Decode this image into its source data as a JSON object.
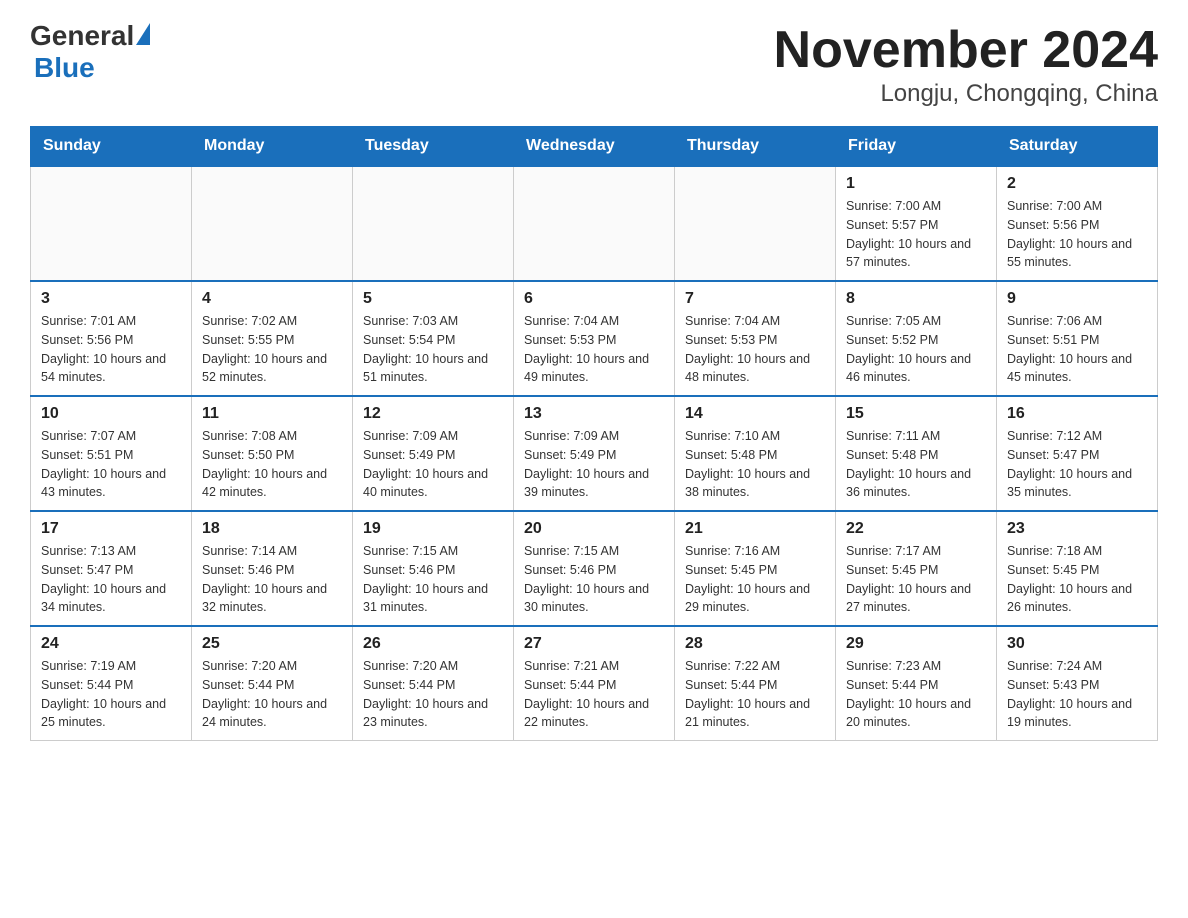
{
  "header": {
    "logo_general": "General",
    "logo_blue": "Blue",
    "title": "November 2024",
    "subtitle": "Longju, Chongqing, China"
  },
  "calendar": {
    "days_of_week": [
      "Sunday",
      "Monday",
      "Tuesday",
      "Wednesday",
      "Thursday",
      "Friday",
      "Saturday"
    ],
    "weeks": [
      [
        {
          "day": "",
          "sunrise": "",
          "sunset": "",
          "daylight": ""
        },
        {
          "day": "",
          "sunrise": "",
          "sunset": "",
          "daylight": ""
        },
        {
          "day": "",
          "sunrise": "",
          "sunset": "",
          "daylight": ""
        },
        {
          "day": "",
          "sunrise": "",
          "sunset": "",
          "daylight": ""
        },
        {
          "day": "",
          "sunrise": "",
          "sunset": "",
          "daylight": ""
        },
        {
          "day": "1",
          "sunrise": "Sunrise: 7:00 AM",
          "sunset": "Sunset: 5:57 PM",
          "daylight": "Daylight: 10 hours and 57 minutes."
        },
        {
          "day": "2",
          "sunrise": "Sunrise: 7:00 AM",
          "sunset": "Sunset: 5:56 PM",
          "daylight": "Daylight: 10 hours and 55 minutes."
        }
      ],
      [
        {
          "day": "3",
          "sunrise": "Sunrise: 7:01 AM",
          "sunset": "Sunset: 5:56 PM",
          "daylight": "Daylight: 10 hours and 54 minutes."
        },
        {
          "day": "4",
          "sunrise": "Sunrise: 7:02 AM",
          "sunset": "Sunset: 5:55 PM",
          "daylight": "Daylight: 10 hours and 52 minutes."
        },
        {
          "day": "5",
          "sunrise": "Sunrise: 7:03 AM",
          "sunset": "Sunset: 5:54 PM",
          "daylight": "Daylight: 10 hours and 51 minutes."
        },
        {
          "day": "6",
          "sunrise": "Sunrise: 7:04 AM",
          "sunset": "Sunset: 5:53 PM",
          "daylight": "Daylight: 10 hours and 49 minutes."
        },
        {
          "day": "7",
          "sunrise": "Sunrise: 7:04 AM",
          "sunset": "Sunset: 5:53 PM",
          "daylight": "Daylight: 10 hours and 48 minutes."
        },
        {
          "day": "8",
          "sunrise": "Sunrise: 7:05 AM",
          "sunset": "Sunset: 5:52 PM",
          "daylight": "Daylight: 10 hours and 46 minutes."
        },
        {
          "day": "9",
          "sunrise": "Sunrise: 7:06 AM",
          "sunset": "Sunset: 5:51 PM",
          "daylight": "Daylight: 10 hours and 45 minutes."
        }
      ],
      [
        {
          "day": "10",
          "sunrise": "Sunrise: 7:07 AM",
          "sunset": "Sunset: 5:51 PM",
          "daylight": "Daylight: 10 hours and 43 minutes."
        },
        {
          "day": "11",
          "sunrise": "Sunrise: 7:08 AM",
          "sunset": "Sunset: 5:50 PM",
          "daylight": "Daylight: 10 hours and 42 minutes."
        },
        {
          "day": "12",
          "sunrise": "Sunrise: 7:09 AM",
          "sunset": "Sunset: 5:49 PM",
          "daylight": "Daylight: 10 hours and 40 minutes."
        },
        {
          "day": "13",
          "sunrise": "Sunrise: 7:09 AM",
          "sunset": "Sunset: 5:49 PM",
          "daylight": "Daylight: 10 hours and 39 minutes."
        },
        {
          "day": "14",
          "sunrise": "Sunrise: 7:10 AM",
          "sunset": "Sunset: 5:48 PM",
          "daylight": "Daylight: 10 hours and 38 minutes."
        },
        {
          "day": "15",
          "sunrise": "Sunrise: 7:11 AM",
          "sunset": "Sunset: 5:48 PM",
          "daylight": "Daylight: 10 hours and 36 minutes."
        },
        {
          "day": "16",
          "sunrise": "Sunrise: 7:12 AM",
          "sunset": "Sunset: 5:47 PM",
          "daylight": "Daylight: 10 hours and 35 minutes."
        }
      ],
      [
        {
          "day": "17",
          "sunrise": "Sunrise: 7:13 AM",
          "sunset": "Sunset: 5:47 PM",
          "daylight": "Daylight: 10 hours and 34 minutes."
        },
        {
          "day": "18",
          "sunrise": "Sunrise: 7:14 AM",
          "sunset": "Sunset: 5:46 PM",
          "daylight": "Daylight: 10 hours and 32 minutes."
        },
        {
          "day": "19",
          "sunrise": "Sunrise: 7:15 AM",
          "sunset": "Sunset: 5:46 PM",
          "daylight": "Daylight: 10 hours and 31 minutes."
        },
        {
          "day": "20",
          "sunrise": "Sunrise: 7:15 AM",
          "sunset": "Sunset: 5:46 PM",
          "daylight": "Daylight: 10 hours and 30 minutes."
        },
        {
          "day": "21",
          "sunrise": "Sunrise: 7:16 AM",
          "sunset": "Sunset: 5:45 PM",
          "daylight": "Daylight: 10 hours and 29 minutes."
        },
        {
          "day": "22",
          "sunrise": "Sunrise: 7:17 AM",
          "sunset": "Sunset: 5:45 PM",
          "daylight": "Daylight: 10 hours and 27 minutes."
        },
        {
          "day": "23",
          "sunrise": "Sunrise: 7:18 AM",
          "sunset": "Sunset: 5:45 PM",
          "daylight": "Daylight: 10 hours and 26 minutes."
        }
      ],
      [
        {
          "day": "24",
          "sunrise": "Sunrise: 7:19 AM",
          "sunset": "Sunset: 5:44 PM",
          "daylight": "Daylight: 10 hours and 25 minutes."
        },
        {
          "day": "25",
          "sunrise": "Sunrise: 7:20 AM",
          "sunset": "Sunset: 5:44 PM",
          "daylight": "Daylight: 10 hours and 24 minutes."
        },
        {
          "day": "26",
          "sunrise": "Sunrise: 7:20 AM",
          "sunset": "Sunset: 5:44 PM",
          "daylight": "Daylight: 10 hours and 23 minutes."
        },
        {
          "day": "27",
          "sunrise": "Sunrise: 7:21 AM",
          "sunset": "Sunset: 5:44 PM",
          "daylight": "Daylight: 10 hours and 22 minutes."
        },
        {
          "day": "28",
          "sunrise": "Sunrise: 7:22 AM",
          "sunset": "Sunset: 5:44 PM",
          "daylight": "Daylight: 10 hours and 21 minutes."
        },
        {
          "day": "29",
          "sunrise": "Sunrise: 7:23 AM",
          "sunset": "Sunset: 5:44 PM",
          "daylight": "Daylight: 10 hours and 20 minutes."
        },
        {
          "day": "30",
          "sunrise": "Sunrise: 7:24 AM",
          "sunset": "Sunset: 5:43 PM",
          "daylight": "Daylight: 10 hours and 19 minutes."
        }
      ]
    ]
  }
}
